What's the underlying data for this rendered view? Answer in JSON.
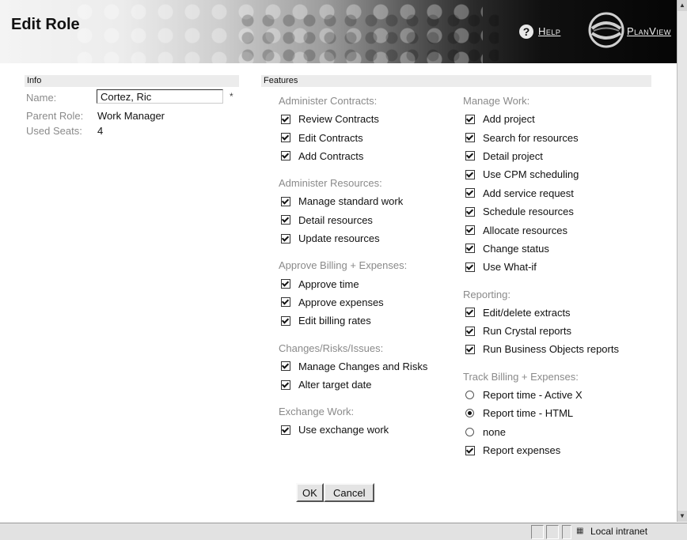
{
  "header": {
    "title": "Edit Role",
    "help_label": "Help",
    "brand_label": "PlanView"
  },
  "info": {
    "section_label": "Info",
    "name_label": "Name:",
    "name_value": "Cortez, Ric",
    "required_marker": "*",
    "parent_role_label": "Parent Role:",
    "parent_role_value": "Work Manager",
    "used_seats_label": "Used Seats:",
    "used_seats_value": "4"
  },
  "features": {
    "section_label": "Features",
    "left_groups": [
      {
        "title": "Administer Contracts:",
        "items": [
          {
            "label": "Review Contracts",
            "checked": true
          },
          {
            "label": "Edit Contracts",
            "checked": true
          },
          {
            "label": "Add Contracts",
            "checked": true
          }
        ]
      },
      {
        "title": "Administer Resources:",
        "items": [
          {
            "label": "Manage standard work",
            "checked": true
          },
          {
            "label": "Detail resources",
            "checked": true
          },
          {
            "label": "Update resources",
            "checked": true
          }
        ]
      },
      {
        "title": "Approve Billing + Expenses:",
        "items": [
          {
            "label": "Approve time",
            "checked": true
          },
          {
            "label": "Approve expenses",
            "checked": true
          },
          {
            "label": "Edit billing rates",
            "checked": true
          }
        ]
      },
      {
        "title": "Changes/Risks/Issues:",
        "items": [
          {
            "label": "Manage Changes and Risks",
            "checked": true
          },
          {
            "label": "Alter target date",
            "checked": true
          }
        ]
      },
      {
        "title": "Exchange Work:",
        "items": [
          {
            "label": "Use exchange work",
            "checked": true
          }
        ]
      }
    ],
    "right_groups": [
      {
        "title": "Manage Work:",
        "items": [
          {
            "label": "Add project",
            "checked": true
          },
          {
            "label": "Search for resources",
            "checked": true
          },
          {
            "label": "Detail project",
            "checked": true
          },
          {
            "label": "Use CPM scheduling",
            "checked": true
          },
          {
            "label": "Add service request",
            "checked": true
          },
          {
            "label": "Schedule resources",
            "checked": true
          },
          {
            "label": "Allocate resources",
            "checked": true
          },
          {
            "label": "Change status",
            "checked": true
          },
          {
            "label": "Use What-if",
            "checked": true
          }
        ]
      },
      {
        "title": "Reporting:",
        "items": [
          {
            "label": "Edit/delete extracts",
            "checked": true
          },
          {
            "label": "Run Crystal reports",
            "checked": true
          },
          {
            "label": "Run Business Objects reports",
            "checked": true
          }
        ]
      },
      {
        "title": "Track Billing + Expenses:",
        "items": [
          {
            "label": "Report time - Active X",
            "type": "radio",
            "checked": false
          },
          {
            "label": "Report time - HTML",
            "type": "radio",
            "checked": true
          },
          {
            "label": "none",
            "type": "radio",
            "checked": false
          },
          {
            "label": "Report expenses",
            "checked": true
          }
        ]
      }
    ]
  },
  "buttons": {
    "ok_label": "OK",
    "cancel_label": "Cancel"
  },
  "statusbar": {
    "zone_label": "Local intranet"
  }
}
